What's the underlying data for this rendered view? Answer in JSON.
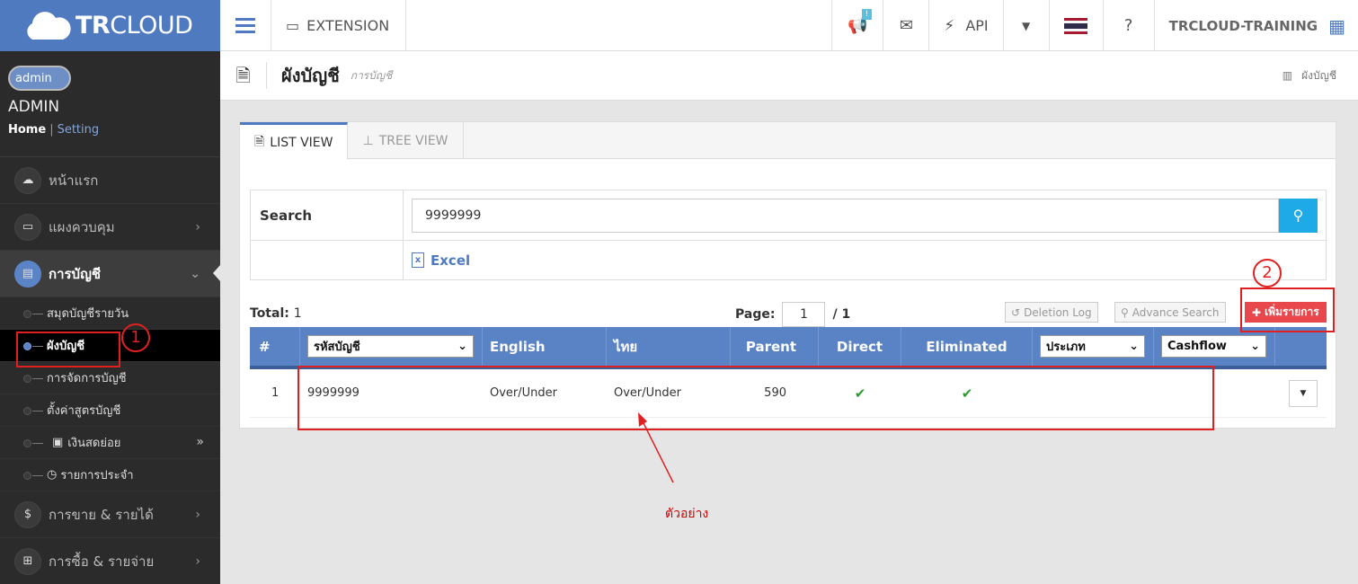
{
  "brand": {
    "logo_bold": "TR",
    "logo_light": "CLOUD"
  },
  "user": {
    "avatar_alt": "admin",
    "name": "ADMIN",
    "home": "Home",
    "sep": "|",
    "setting": "Setting"
  },
  "sidebar": {
    "items": [
      {
        "label": "หน้าแรก"
      },
      {
        "label": "แผงควบคุม"
      },
      {
        "label": "การบัญชี"
      }
    ],
    "sub": [
      {
        "label": "สมุดบัญชีรายวัน"
      },
      {
        "label": "ผังบัญชี"
      },
      {
        "label": "การจัดการบัญชี"
      },
      {
        "label": "ตั้งค่าสูตรบัญชี"
      },
      {
        "label": "เงินสดย่อย"
      },
      {
        "label": "รายการประจำ"
      }
    ],
    "bottom": [
      {
        "label": "การขาย & รายได้"
      },
      {
        "label": "การซื้อ & รายจ่าย"
      }
    ]
  },
  "topbar": {
    "extension": "EXTENSION",
    "badge": "!",
    "api": "API",
    "company": "TRCLOUD-TRAINING"
  },
  "title": {
    "main": "ผังบัญชี",
    "sub": "การบัญชี",
    "breadcrumb": "ผังบัญชี"
  },
  "tabs": [
    {
      "label": "LIST VIEW"
    },
    {
      "label": "TREE VIEW"
    }
  ],
  "search": {
    "label": "Search",
    "value": "9999999",
    "excel": "Excel"
  },
  "list": {
    "total_label": "Total:",
    "total": "1",
    "page_label": "Page:",
    "page": "1",
    "page_of": "/ 1",
    "deletion_log": "Deletion Log",
    "advance_search": "Advance Search",
    "add": "เพิ่มรายการ"
  },
  "columns": {
    "num": "#",
    "code": "รหัสบัญชี",
    "english": "English",
    "thai": "ไทย",
    "parent": "Parent",
    "direct": "Direct",
    "eliminated": "Eliminated",
    "type": "ประเภท",
    "cashflow": "Cashflow"
  },
  "rows": [
    {
      "num": "1",
      "code": "9999999",
      "english": "Over/Under",
      "thai": "Over/Under",
      "parent": "590",
      "direct": "✔",
      "eliminated": "✔"
    }
  ],
  "annotations": {
    "one": "1",
    "two": "2",
    "example": "ตัวอย่าง"
  },
  "colors": {
    "brand_blue": "#4f7ac0",
    "add_red": "#e8474c",
    "annotation_red": "#e02020"
  }
}
